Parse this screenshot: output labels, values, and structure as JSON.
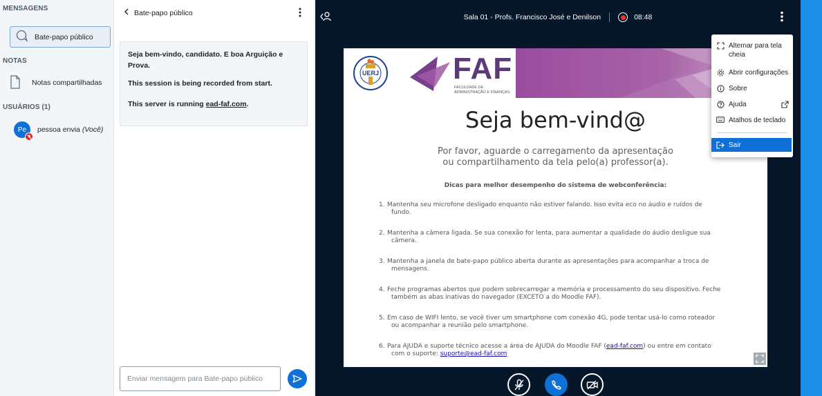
{
  "userlist": {
    "messages_title": "MENSAGENS",
    "public_chat": "Bate-papo público",
    "notes_title": "NOTAS",
    "shared_notes": "Notas compartilhadas",
    "users_title": "USUÁRIOS (1)",
    "user": {
      "initials": "Pe",
      "name": "pessoa envia",
      "you_label": "(Você)"
    }
  },
  "chat": {
    "header": "Bate-papo público",
    "welcome": "Seja bem-vindo, candidato. E boa Arguição e Prova.",
    "recorded": "This session is being recorded from start.",
    "server_prefix": "This server is running ",
    "server_link": "ead-faf.com",
    "server_suffix": ".",
    "input_placeholder": "Enviar mensagem para Bate-papo público"
  },
  "topbar": {
    "title": "Sala 01 - Profs. Francisco José e Denilson",
    "rec_time": "08:48"
  },
  "slide": {
    "uerj_text": "UERJ",
    "faf_logo_text": "FAF",
    "faf_sub_line1": "FACULDADE DE",
    "faf_sub_line2": "ADMINISTRAÇÃO E FINANÇAS",
    "title": "Seja bem-vind@",
    "subtitle_line1": "Por favor, aguarde o carregamento da apresentação",
    "subtitle_line2": "ou compartilhamento da tela pelo(a) professor(a).",
    "tips_title": "Dicas para melhor desempenho do sistema de webconferência:",
    "tips": [
      {
        "num": "1.",
        "line1": "Mantenha seu microfone desligado enquanto não estiver falando. Isso evita eco no áudio e ruídos de",
        "line2": "fundo."
      },
      {
        "num": "2.",
        "line1": "Mantenha a câmera ligada. Se sua conexão for lenta, para aumentar a qualidade do áudio desligue sua",
        "line2": "câmera."
      },
      {
        "num": "3.",
        "line1": "Mantenha a janela de bate-papo público aberta durante as apresentações para acompanhar a troca de",
        "line2": "mensagens."
      },
      {
        "num": "4.",
        "line1": "Feche programas abertos que podem sobrecarregar a memória e processamento do seu dispositivo. Feche",
        "line2": "também as abas inativas do navegador (EXCETO a do Moodle FAF)."
      },
      {
        "num": "5.",
        "line1": "Em caso de WIFI lento, se você tiver um smartphone com conexão 4G, pode tentar usá-lo como roteador",
        "line2": "ou acompanhar a reunião pelo smartphone."
      }
    ],
    "tip6": {
      "num": "6.",
      "text1": "Para AJUDA e suporte técnico acesse a área de AJUDA do Moodle FAF (",
      "link1": "ead-faf.com",
      "text2": ") ou entre em contato",
      "text3": "com o suporte: ",
      "link2": "suporte@ead-faf.com"
    }
  },
  "menu": {
    "fullscreen": "Alternar para tela cheia",
    "settings": "Abrir configurações",
    "about": "Sobre",
    "help": "Ajuda",
    "shortcuts": "Atalhos de teclado",
    "exit": "Sair"
  },
  "colors": {
    "primary": "#0f70d7",
    "main_bg": "#06172a",
    "slide_accent": "#9a4c9f",
    "record": "#e53935"
  }
}
